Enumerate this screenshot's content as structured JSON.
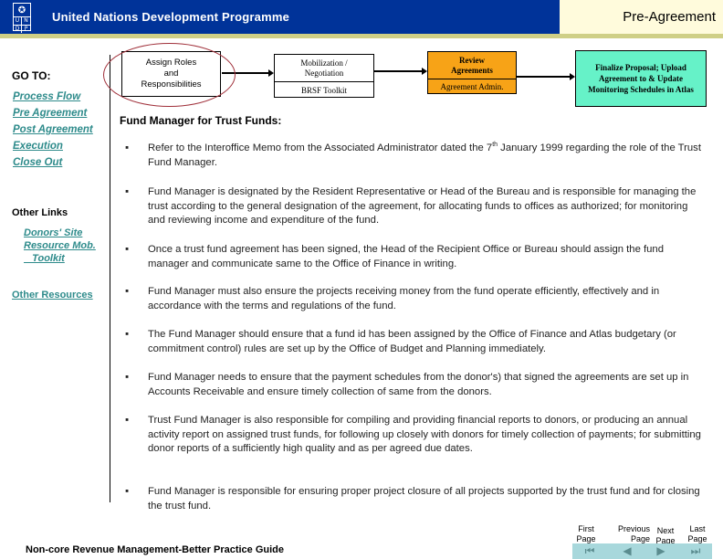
{
  "header": {
    "org_name": "United Nations Development Programme",
    "logo_letters": [
      "U",
      "N",
      "D",
      "P"
    ],
    "logo_icon": "un-globe-icon",
    "section_title": "Pre-Agreement",
    "colors": {
      "banner": "#003399",
      "title_box": "#fffbdc",
      "strip": "#cfcf86"
    }
  },
  "sidebar": {
    "goto_title": "GO TO:",
    "nav_links": [
      {
        "label": "Process Flow"
      },
      {
        "label": "Pre Agreement"
      },
      {
        "label": "Post Agreement"
      },
      {
        "label": "Execution"
      },
      {
        "label": "Close Out"
      }
    ],
    "other_links_title": "Other Links",
    "other_links": [
      {
        "label": "Donors' Site"
      },
      {
        "label": "Resource Mob."
      },
      {
        "label": "   Toolkit"
      }
    ],
    "other_resources": "Other Resources",
    "link_color": "#2e8b8b"
  },
  "process_flow": {
    "steps": [
      {
        "title": "Assign Roles and Responsibilities",
        "title_lines": [
          "Assign Roles",
          "and",
          "Responsibilities"
        ],
        "highlighted": true
      },
      {
        "title": "Mobilization / Negotiation",
        "title_lines": [
          "Mobilization /",
          "Negotiation"
        ],
        "sub": "BRSF Toolkit"
      },
      {
        "title": "Review Agreements",
        "title_lines": [
          "Review",
          "Agreements"
        ],
        "sub": "Agreement Admin.",
        "color": "#f7a317"
      },
      {
        "title": "Finalize Proposal; Upload Agreement to & Update Monitoring Schedules in Atlas",
        "color": "#66f2c8"
      }
    ]
  },
  "main": {
    "title": "Fund Manager for Trust Funds:",
    "bullets": [
      {
        "pre": "Refer to the  Interoffice Memo from the Associated Administrator dated the 7",
        "sup": "th",
        "post": " January 1999 regarding the role of the Trust Fund Manager."
      },
      {
        "text": "Fund Manager is designated by the Resident Representative or Head of the Bureau and is responsible for managing the trust according to the general designation of the agreement, for allocating funds to offices as authorized; for monitoring and reviewing income and expenditure of the fund."
      },
      {
        "text": "Once a trust fund agreement has been signed, the Head of the Recipient Office or Bureau should assign the fund manager and communicate same to the Office of Finance in writing."
      },
      {
        "text": "Fund Manager must also ensure the projects receiving money from the fund operate efficiently, effectively and in accordance with the terms and regulations of the fund."
      },
      {
        "text": "The Fund Manager should ensure that a fund id has been assigned by the Office of Finance and Atlas budgetary  (or commitment control) rules are set up by the Office of Budget and Planning immediately."
      },
      {
        "text": "Fund Manager needs to ensure that the payment schedules from the donor's) that signed the agreements are set up in Accounts Receivable and ensure timely collection of same from the donors."
      },
      {
        "text": "Trust Fund Manager is also responsible for compiling and providing financial reports to donors, or producing an annual activity report on assigned trust funds, for following up closely with donors for timely collection of payments; for submitting  donor reports of a sufficiently high quality and as per agreed due dates."
      },
      {
        "text": "Fund Manager is responsible  for ensuring proper project closure of all projects supported by the trust fund and for closing the trust fund."
      }
    ],
    "bullet_glyph": "▪"
  },
  "footer": {
    "title": "Non-core Revenue Management-Better Practice Guide",
    "pager": [
      {
        "line1": "First",
        "line2": "Page",
        "icon": "first-page-icon",
        "glyph": "⏮"
      },
      {
        "line1": "Previous",
        "line2": "Page",
        "icon": "previous-page-icon",
        "glyph": "◀"
      },
      {
        "line1": "Next",
        "line2": "Page",
        "icon": "next-page-icon",
        "glyph": "▶"
      },
      {
        "line1": "Last",
        "line2": "Page",
        "icon": "last-page-icon",
        "glyph": "⏭"
      }
    ],
    "pager_bar_color": "#a8d8dc"
  }
}
